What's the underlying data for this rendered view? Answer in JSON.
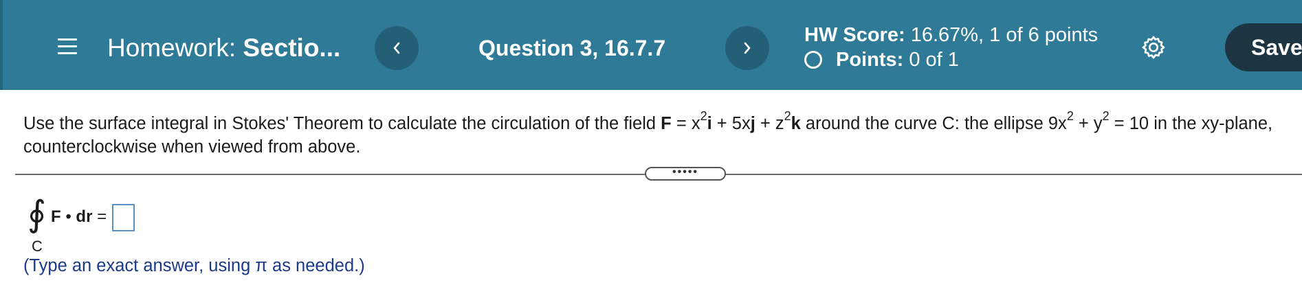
{
  "header": {
    "menu_icon": "hamburger-menu-icon",
    "homework_prefix": "Homework:",
    "homework_name": "Sectio...",
    "prev_icon": "chevron-left-icon",
    "prev_glyph": "‹",
    "next_icon": "chevron-right-icon",
    "next_glyph": "›",
    "question_label": "Question 3, 16.7.7",
    "score_label": "HW Score:",
    "score_value": "16.67%, 1 of 6 points",
    "points_label": "Points:",
    "points_value": "0 of 1",
    "settings_icon": "gear-icon",
    "save_label": "Save",
    "colors": {
      "bar": "#2f7a96",
      "nav_button": "#245f78",
      "save_button": "#1d3442"
    }
  },
  "problem": {
    "intro": "Use the surface integral in Stokes' Theorem to calculate the circulation of the field",
    "field_name": "F",
    "field_eq": "=",
    "t1_base": "x",
    "t1_exp": "2",
    "t1_unit": "i",
    "t2_plus": "+ 5x",
    "t2_unit": "j",
    "t3_plus": "+ z",
    "t3_exp": "2",
    "t3_unit": "k",
    "around": "around the curve C: the ellipse 9x",
    "ell_exp1": "2",
    "ell_mid": "+ y",
    "ell_exp2": "2",
    "ell_end": "= 10 in the xy-plane,",
    "line2": "counterclockwise when viewed from above."
  },
  "expand_button": {
    "label": "•••••"
  },
  "answer": {
    "integral_symbol": "∮",
    "integral_sub": "C",
    "integrand_F": "F",
    "integrand_dot": "•",
    "integrand_dr": "dr",
    "equals": "=",
    "box_value": "",
    "hint": "(Type an exact answer, using π as needed.)"
  }
}
